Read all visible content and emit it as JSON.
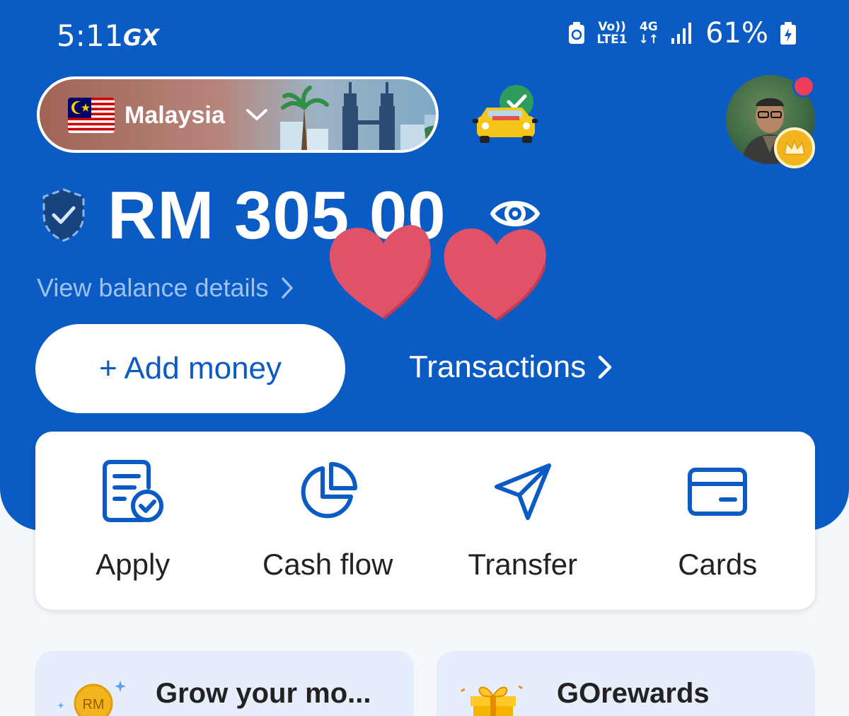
{
  "status_bar": {
    "time": "5:11",
    "carrier_tag": "GX",
    "volte": "Vo))",
    "lte": "LTE1",
    "network": "4G",
    "battery": "61%"
  },
  "header": {
    "country": "Malaysia",
    "icons": [
      "flag-malaysia-icon",
      "chevron-down-icon",
      "taxi-verified-icon",
      "avatar",
      "crown-icon"
    ]
  },
  "balance": {
    "amount": "RM 305.00",
    "view_details": "View balance details"
  },
  "buttons": {
    "add_money": "+ Add money",
    "transactions": "Transactions"
  },
  "actions": [
    {
      "label": "Apply",
      "icon": "document-check-icon"
    },
    {
      "label": "Cash flow",
      "icon": "pie-chart-icon"
    },
    {
      "label": "Transfer",
      "icon": "send-icon"
    },
    {
      "label": "Cards",
      "icon": "card-icon"
    }
  ],
  "promos": {
    "left_title": "Grow your mo...",
    "left_badge": "RM",
    "right_title": "GOrewards"
  },
  "colors": {
    "primary": "#0a5bc4",
    "accent_red": "#ef3e5c",
    "heart": "#e05268"
  }
}
